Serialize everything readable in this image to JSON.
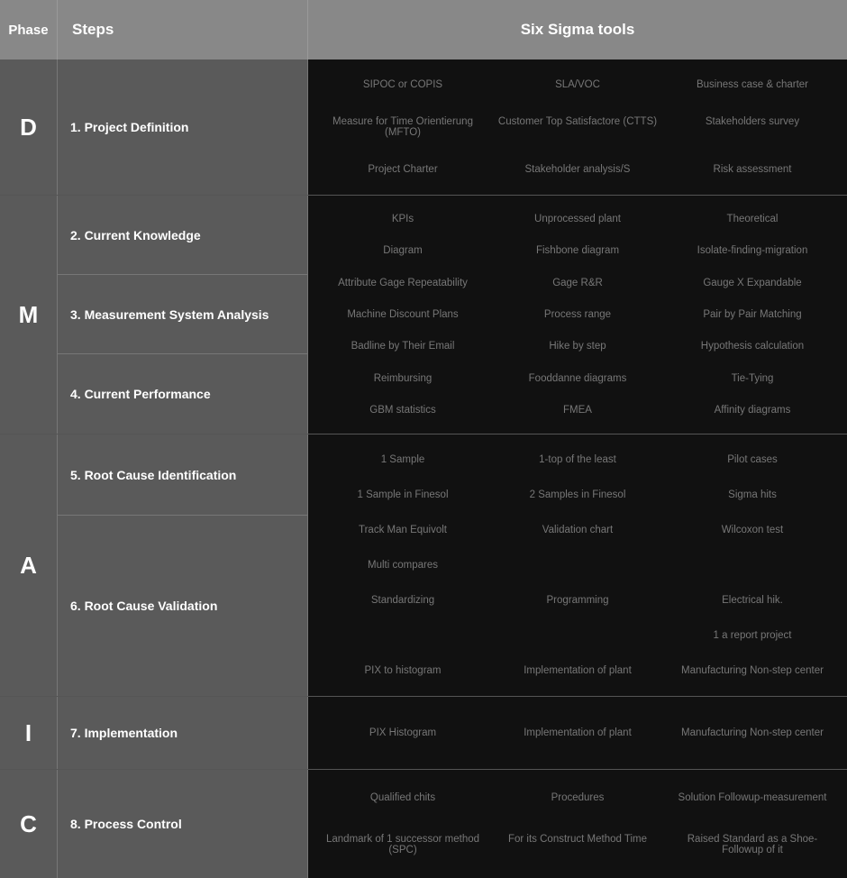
{
  "header": {
    "phase_label": "Phase",
    "steps_label": "Steps",
    "tools_label": "Six Sigma tools"
  },
  "phases": [
    {
      "id": "D",
      "label": "D",
      "steps": [
        {
          "number": "1.",
          "name": "Project Definition"
        }
      ],
      "tools": [
        [
          "SIPOC or COPIS",
          "SLA/VOC",
          "Business case & charter"
        ],
        [
          "Measure for Time Orientierung (MFTO)",
          "Customer Top Satisfactore (CTTS)",
          "Stakeholders survey"
        ],
        [
          "Project Charter",
          "Stakeholder analysis/S",
          "Risk assessment"
        ]
      ]
    },
    {
      "id": "M",
      "label": "M",
      "steps": [
        {
          "number": "2.",
          "name": "Current Knowledge"
        },
        {
          "number": "3.",
          "name": "Measurement System Analysis"
        },
        {
          "number": "4.",
          "name": "Current Performance"
        }
      ],
      "tools_by_step": [
        [
          [
            "KPIs",
            "Unprocessed plant",
            "Theoretical"
          ],
          [
            "Diagram",
            "Fishbone diagram",
            "Isolate-finding-migration"
          ]
        ],
        [
          [
            "Attribute Gage Repeatability",
            "Gage R&R",
            "Gauge X Expandable"
          ],
          [
            "Machine Discount Plans",
            "Process range",
            "Pair by Pair Matching"
          ],
          [
            "Badline by Their Email",
            "Hike by step",
            "Hypothesis calculation"
          ]
        ],
        [
          [
            "Reimbursing",
            "Fooddanne diagrams",
            "Tie-Tying"
          ],
          [
            "GBM statistics",
            "FMEA",
            "Affinity diagrams"
          ]
        ]
      ]
    },
    {
      "id": "A",
      "label": "A",
      "steps": [
        {
          "number": "5.",
          "name": "Root Cause Identification"
        },
        {
          "number": "6.",
          "name": "Root Cause Validation"
        }
      ],
      "tools_by_step": [
        [
          [
            "1 Sample",
            "1-top of the least",
            "Pilot cases"
          ],
          [
            "1 Sample in Finesol",
            "2 Samples in Finesol",
            "Sigma hits"
          ],
          [
            "Track Man Equivolt",
            "Validation chart",
            "Wilcoxon test"
          ],
          [
            "Multi compares",
            "",
            ""
          ]
        ],
        [
          [
            "Standardizing",
            "Programming",
            "Electrical hik."
          ],
          [
            "",
            "",
            "1 a report project"
          ],
          [
            "PIX to histogram",
            "Implementation of plant",
            "Manufacturing / Non-step center"
          ]
        ]
      ]
    },
    {
      "id": "I",
      "label": "I",
      "steps": [
        {
          "number": "7.",
          "name": "Implementation"
        }
      ],
      "tools": [
        [
          "PIX Histogram",
          "Implementation of plant",
          "Manufacturing Non-step center"
        ]
      ]
    },
    {
      "id": "C",
      "label": "C",
      "steps": [
        {
          "number": "8.",
          "name": "Process Control"
        }
      ],
      "tools": [
        [
          "Qualified chits",
          "Procedures",
          "Solution Followup-measurement"
        ],
        [
          "Landmark of 1 successor method (SPC)",
          "For its Construct Method Time",
          "Raised Standard as a Shoe-Followup of it"
        ]
      ]
    }
  ]
}
